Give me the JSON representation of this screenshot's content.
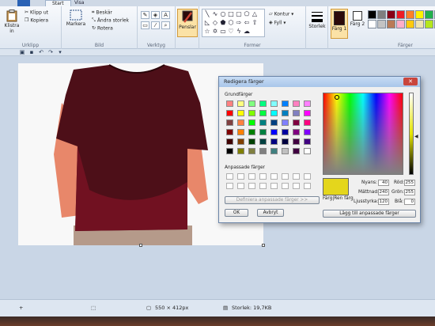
{
  "tabs": {
    "file": "",
    "start": "Start",
    "view": "Visa"
  },
  "clipboard": {
    "paste": "Klistra in",
    "cut": "Klipp ut",
    "copy": "Kopiera",
    "group": "Urklipp"
  },
  "image": {
    "select": "Markera",
    "crop": "Beskär",
    "resize": "Ändra storlek",
    "rotate": "Rotera",
    "group": "Bild"
  },
  "tools": {
    "group": "Verktyg"
  },
  "brushes": {
    "label": "Penslar"
  },
  "shapes": {
    "outline": "Kontur",
    "fill": "Fyll",
    "group": "Former"
  },
  "size": {
    "label": "Storlek"
  },
  "colors": {
    "color1": "Färg 1",
    "color2": "Färg 2",
    "group": "Färger",
    "color1_value": "#2b0a0a",
    "color2_value": "#ffffff",
    "palette": [
      "#000000",
      "#7f7f7f",
      "#880015",
      "#ed1c24",
      "#ff7f27",
      "#fff200",
      "#22b14c",
      "#00a2e8",
      "#3f48cc",
      "#a349a4",
      "#ffffff",
      "#c3c3c3",
      "#b97a57",
      "#ffaec9",
      "#ffc90e",
      "#efe4b0",
      "#b5e61d",
      "#99d9ea",
      "#7092be",
      "#c8bfe7"
    ]
  },
  "statusbar": {
    "dimensions": "550 × 412px",
    "size": "Storlek: 19,7KB"
  },
  "dialog": {
    "title": "Redigera färger",
    "close": "✕",
    "basic_colors_label": "Grundfärger",
    "custom_colors_label": "Anpassade färger",
    "define_custom": "Definiera anpassade färger >>",
    "ok": "OK",
    "cancel": "Avbryt",
    "color_solid_label": "Färg|Ren färg",
    "hue_label": "Nyans:",
    "hue": "40",
    "sat_label": "Mättnad:",
    "sat": "240",
    "lum_label": "Ljusstyrka:",
    "lum": "120",
    "red_label": "Röd:",
    "red": "255",
    "green_label": "Grön:",
    "green": "255",
    "blue_label": "Blå:",
    "blue": "0",
    "add_custom": "Lägg till anpassade färger",
    "selected_color": "#e4d61c",
    "basic_colors": [
      "#ff8080",
      "#ffff80",
      "#80ff80",
      "#00ff80",
      "#80ffff",
      "#0080ff",
      "#ff80c0",
      "#ff80ff",
      "#ff0000",
      "#ffff00",
      "#80ff00",
      "#00ff40",
      "#00ffff",
      "#0080c0",
      "#8080c0",
      "#ff00ff",
      "#804040",
      "#ff8040",
      "#00ff00",
      "#008080",
      "#004080",
      "#8080ff",
      "#800040",
      "#ff0080",
      "#800000",
      "#ff8000",
      "#008000",
      "#008040",
      "#0000ff",
      "#0000a0",
      "#800080",
      "#8000ff",
      "#400000",
      "#804000",
      "#004000",
      "#004040",
      "#000080",
      "#000040",
      "#400040",
      "#400080",
      "#000000",
      "#808000",
      "#808040",
      "#808080",
      "#408080",
      "#c0c0c0",
      "#400040",
      "#ffffff"
    ]
  }
}
